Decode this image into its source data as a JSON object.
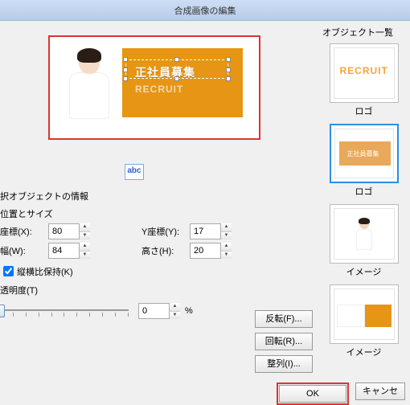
{
  "window": {
    "title": "合成画像の編集"
  },
  "side": {
    "header": "オブジェクト一覧",
    "items": [
      {
        "label": "ロゴ",
        "recruit_text": "RECRUIT"
      },
      {
        "label": "ロゴ",
        "logo_text": "正社員募集"
      },
      {
        "label": "イメージ"
      },
      {
        "label": "イメージ"
      }
    ]
  },
  "canvas": {
    "jp_text": "正社員募集",
    "en_text": "RECRUIT"
  },
  "abc_button": "abc",
  "section": {
    "info_title": "択オブジェクトの情報",
    "pos_size": "位置とサイズ",
    "x_label": "座標(X):",
    "y_label": "Y座標(Y):",
    "w_label": "幅(W):",
    "h_label": "高さ(H):",
    "x_value": "80",
    "y_value": "17",
    "w_value": "84",
    "h_value": "20",
    "aspect_label": "縦横比保持(K)",
    "opacity_label": "透明度(T)",
    "opacity_value": "0",
    "percent": "%",
    "flip": "反転(F)...",
    "rotate": "回転(R)...",
    "align": "整列(I)..."
  },
  "footer": {
    "ok": "OK",
    "cancel": "キャンセ"
  }
}
